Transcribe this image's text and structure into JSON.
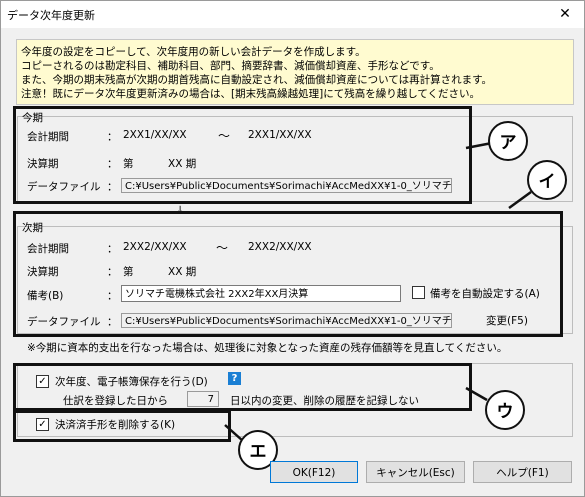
{
  "window": {
    "title": "データ次年度更新",
    "close_glyph": "✕"
  },
  "info": {
    "lines": [
      "今年度の設定をコピーして、次年度用の新しい会計データを作成します。",
      "コピーされるのは勘定科目、補助科目、部門、摘要辞書、減価償却資産、手形などです。",
      "また、今期の期末残高が次期の期首残高に自動設定され、減価償却資産については再計算されます。",
      "注意！既にデータ次年度更新済みの場合は、[期末残高繰越処理]にて残高を繰り越してください。"
    ]
  },
  "current": {
    "group_label": "今期",
    "period_label": "会計期間",
    "colon": "：",
    "period_start": "2XX1/XX/XX",
    "tilde": "～",
    "period_end": "2XX1/XX/XX",
    "term_label": "決算期",
    "term_prefix": "第",
    "term_value": "XX 期",
    "file_label": "データファイル",
    "file_path": "C:¥Users¥Public¥Documents¥Sorimachi¥AccMedXX¥1-0_ソリマチ"
  },
  "arrow_glyph": "↓",
  "next": {
    "group_label": "次期",
    "period_label": "会計期間",
    "colon": "：",
    "period_start": "2XX2/XX/XX",
    "tilde": "～",
    "period_end": "2XX2/XX/XX",
    "term_label": "決算期",
    "term_prefix": "第",
    "term_value": "XX 期",
    "note_label": "備考(B)",
    "note_value": "ソリマチ電機株式会社 2XX2年XX月決算",
    "auto_note_label": "備考を自動設定する(A)",
    "auto_note_checked": false,
    "file_label": "データファイル",
    "file_path": "C:¥Users¥Public¥Documents¥Sorimachi¥AccMedXX¥1-0_ソリマチ",
    "change_button": "変更(F5)"
  },
  "warning": "※今期に資本的支出を行なった場合は、処理後に対象となった資産の残存価額等を見直してください。",
  "options": {
    "ledger_label": "次年度、電子帳簿保存を行う(D)",
    "ledger_checked": true,
    "help_glyph": "?",
    "history_prefix": "仕訳を登録した日から",
    "history_days": "7",
    "history_suffix": "日以内の変更、削除の履歴を記録しない",
    "delete_bills_label": "決済済手形を削除する(K)",
    "delete_bills_checked": true,
    "check_glyph": "✓"
  },
  "callouts": {
    "a": "ア",
    "i": "イ",
    "u": "ウ",
    "e": "エ"
  },
  "buttons": {
    "ok": "OK(F12)",
    "cancel": "キャンセル(Esc)",
    "help": "ヘルプ(F1)"
  }
}
